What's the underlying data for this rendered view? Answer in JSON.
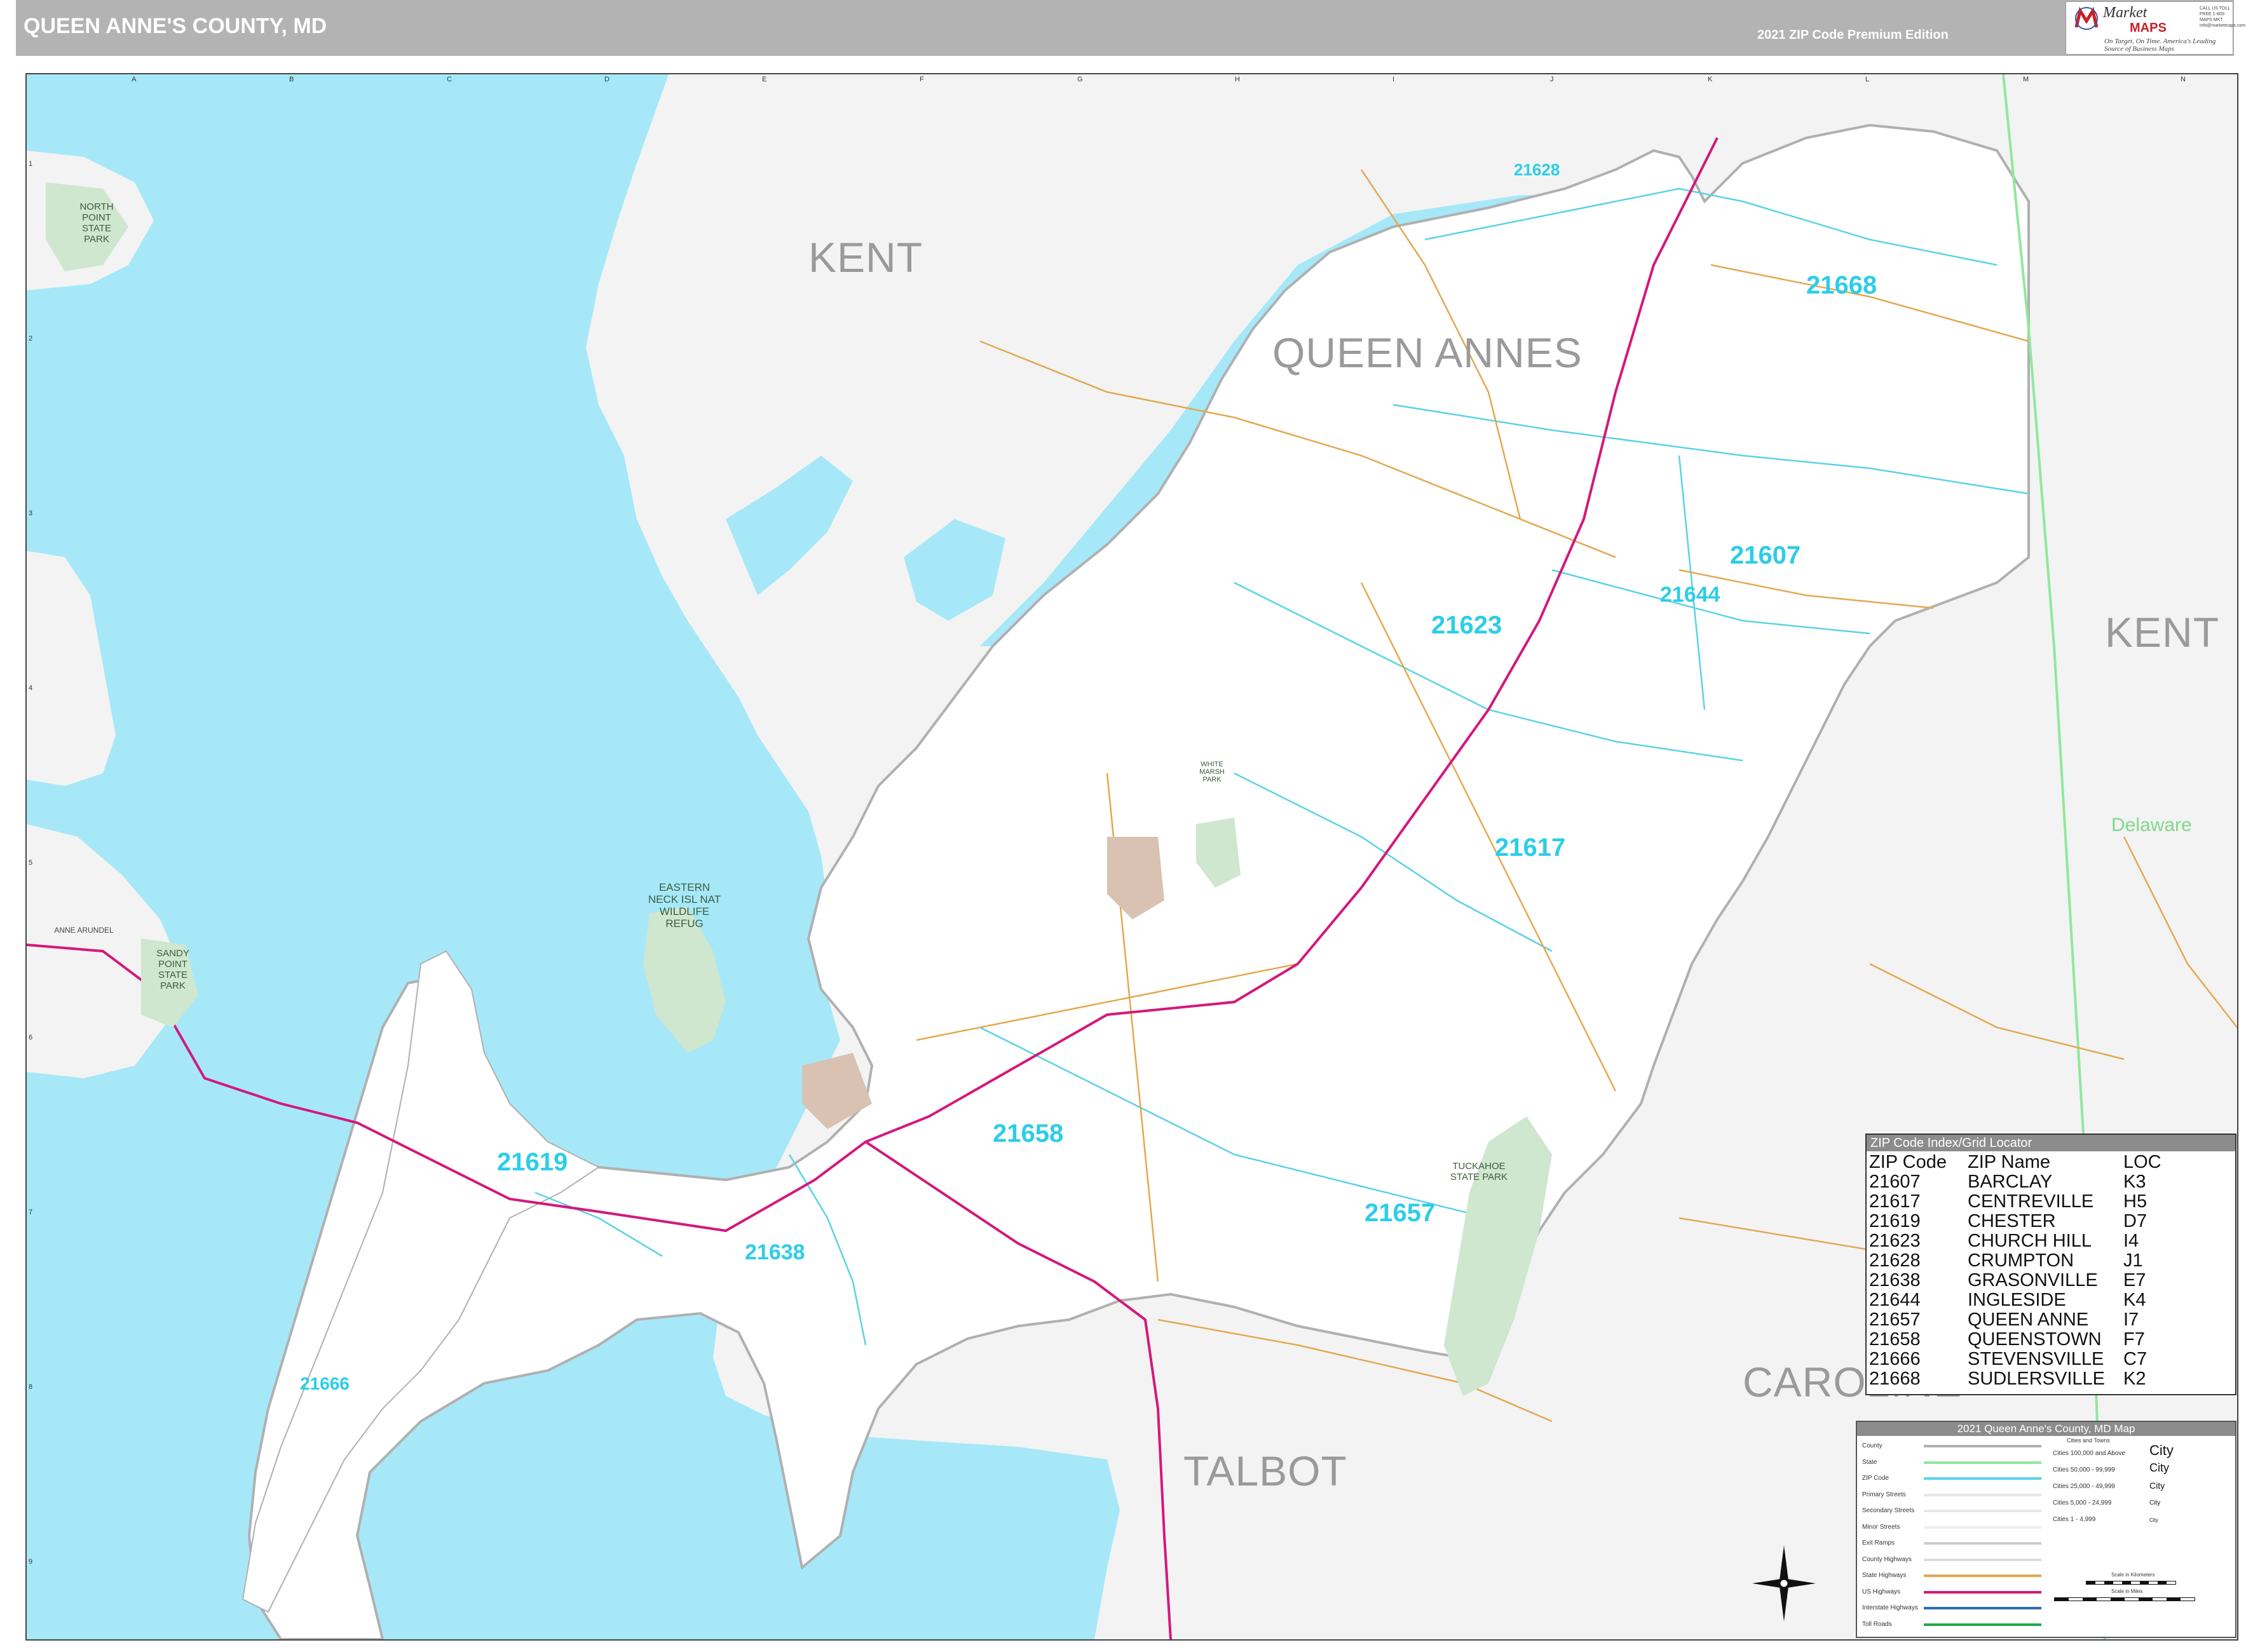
{
  "header": {
    "title": "QUEEN ANNE'S COUNTY, MD",
    "edition": "2021 ZIP Code Premium Edition"
  },
  "logo": {
    "script": "Market",
    "maps": "MAPS",
    "tagline": "On Target, On Time. America's Leading Source of Business Maps",
    "contact": "CALL US TOLL FREE 1-800-MAPS MKT info@marketmaps.com"
  },
  "colors": {
    "water": "#a6e8f8",
    "land": "#f3f3f3",
    "county": "#ffffff",
    "zip_boundary": "#5ad3e6",
    "us_highway": "#d4187c",
    "state_highway": "#e3a850",
    "state_line": "#90e89c",
    "county_line": "#b0b0b0",
    "park": "#cfe6cf",
    "city": "#d9c2b2"
  },
  "grid": {
    "letters": [
      "A",
      "B",
      "C",
      "D",
      "E",
      "F",
      "G",
      "H",
      "I",
      "J",
      "K",
      "L",
      "M",
      "N"
    ],
    "numbers": [
      "1",
      "2",
      "3",
      "4",
      "5",
      "6",
      "7",
      "8",
      "9"
    ]
  },
  "regions": {
    "kent_north": "KENT",
    "queen_annes": "QUEEN ANNES",
    "kent_east": "KENT",
    "talbot": "TALBOT",
    "caroline": "CAROLINE",
    "delaware": "Delaware"
  },
  "zip_labels": [
    {
      "zip": "21628"
    },
    {
      "zip": "21668"
    },
    {
      "zip": "21607"
    },
    {
      "zip": "21644"
    },
    {
      "zip": "21623"
    },
    {
      "zip": "21617"
    },
    {
      "zip": "21658"
    },
    {
      "zip": "21619"
    },
    {
      "zip": "21638"
    },
    {
      "zip": "21657"
    },
    {
      "zip": "21666"
    }
  ],
  "place_labels": {
    "north_point": "NORTH POINT STATE PARK",
    "eastern_neck": "EASTERN NECK ISL NAT WILDLIFE REFUG",
    "sandy_point": "SANDY POINT STATE PARK",
    "tuckahoe": "TUCKAHOE STATE PARK",
    "white_marsh": "WHITE MARSH PARK",
    "anne_arundel": "ANNE ARUNDEL"
  },
  "zip_index": {
    "title": "ZIP Code Index/Grid Locator",
    "headers": [
      "ZIP Code",
      "ZIP Name",
      "LOC"
    ],
    "rows": [
      [
        "21607",
        "BARCLAY",
        "K3"
      ],
      [
        "21617",
        "CENTREVILLE",
        "H5"
      ],
      [
        "21619",
        "CHESTER",
        "D7"
      ],
      [
        "21623",
        "CHURCH HILL",
        "I4"
      ],
      [
        "21628",
        "CRUMPTON",
        "J1"
      ],
      [
        "21638",
        "GRASONVILLE",
        "E7"
      ],
      [
        "21644",
        "INGLESIDE",
        "K4"
      ],
      [
        "21657",
        "QUEEN ANNE",
        "I7"
      ],
      [
        "21658",
        "QUEENSTOWN",
        "F7"
      ],
      [
        "21666",
        "STEVENSVILLE",
        "C7"
      ],
      [
        "21668",
        "SUDLERSVILLE",
        "K2"
      ]
    ]
  },
  "legend": {
    "title": "2021 Queen Anne's County, MD Map",
    "items": [
      "County",
      "State",
      "ZIP Code",
      "Primary Streets",
      "Secondary Streets",
      "Minor Streets",
      "Exit Ramps",
      "County Highways",
      "State Highways",
      "US Highways",
      "Interstate Highways",
      "Toll Roads"
    ],
    "cities_head": "Cities and Towns",
    "cities": [
      {
        "label": "Cities 100,000 and Above",
        "sample": "City"
      },
      {
        "label": "Cities 50,000 - 99,999",
        "sample": "City"
      },
      {
        "label": "Cities 25,000 - 49,999",
        "sample": "City"
      },
      {
        "label": "Cities 5,000 - 24,999",
        "sample": "City"
      },
      {
        "label": "Cities 1 - 4,999",
        "sample": "City"
      }
    ],
    "scale_km": "Scale in Kilometers",
    "scale_mi": "Scale in Miles"
  }
}
